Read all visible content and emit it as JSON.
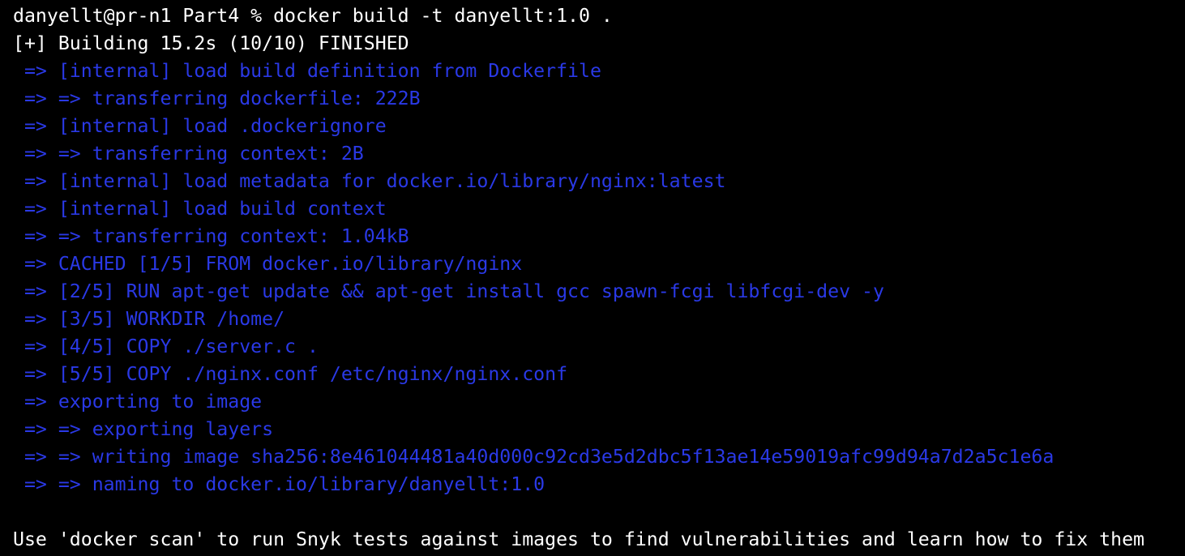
{
  "terminal": {
    "lines": [
      {
        "text": "danyellt@pr-n1 Part4 % docker build -t danyellt:1.0 ."
      },
      {
        "text": "[+] Building 15.2s (10/10) FINISHED"
      },
      {
        "text": " => [internal] load build definition from Dockerfile"
      },
      {
        "text": " => => transferring dockerfile: 222B"
      },
      {
        "text": " => [internal] load .dockerignore"
      },
      {
        "text": " => => transferring context: 2B"
      },
      {
        "text": " => [internal] load metadata for docker.io/library/nginx:latest"
      },
      {
        "text": " => [internal] load build context"
      },
      {
        "text": " => => transferring context: 1.04kB"
      },
      {
        "text": " => CACHED [1/5] FROM docker.io/library/nginx"
      },
      {
        "text": " => [2/5] RUN apt-get update && apt-get install gcc spawn-fcgi libfcgi-dev -y"
      },
      {
        "text": " => [3/5] WORKDIR /home/"
      },
      {
        "text": " => [4/5] COPY ./server.c ."
      },
      {
        "text": " => [5/5] COPY ./nginx.conf /etc/nginx/nginx.conf"
      },
      {
        "text": " => exporting to image"
      },
      {
        "text": " => => exporting layers"
      },
      {
        "text": " => => writing image sha256:8e461044481a40d000c92cd3e5d2dbc5f13ae14e59019afc99d94a7d2a5c1e6a"
      },
      {
        "text": " => => naming to docker.io/library/danyellt:1.0"
      },
      {
        "text": ""
      },
      {
        "text": "Use 'docker scan' to run Snyk tests against images to find vulnerabilities and learn how to fix them"
      }
    ]
  },
  "colors": {
    "background": "#000000",
    "foreground": "#ffffff",
    "buildkit_blue": "#2a39e6"
  }
}
